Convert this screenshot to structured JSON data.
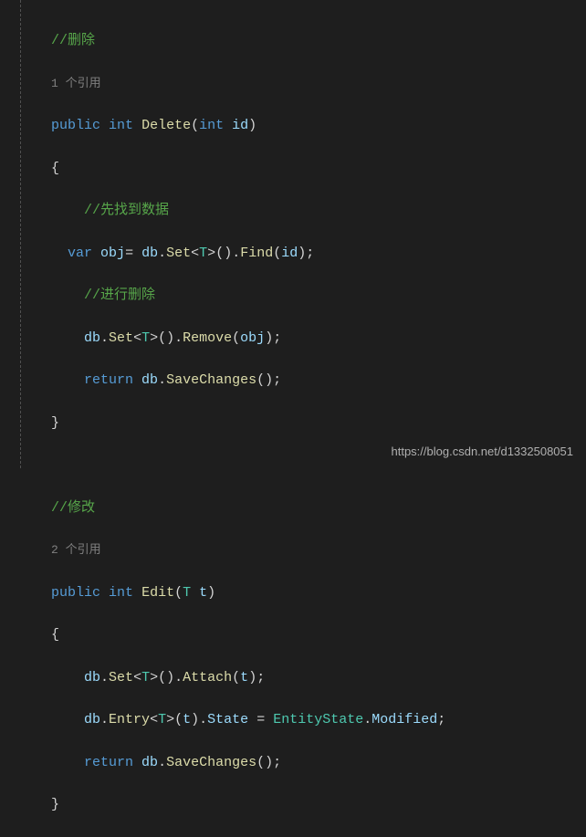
{
  "code": {
    "delete": {
      "comment_title": "//删除",
      "ref_count": "1 个引用",
      "sig_public": "public",
      "sig_int": "int",
      "sig_name": "Delete",
      "sig_paren_open": "(",
      "sig_param_type": "int",
      "sig_param_name": "id",
      "sig_paren_close": ")",
      "brace_open": "{",
      "comment_find": "//先找到数据",
      "l_var": "var",
      "l_obj": "obj",
      "l_eq": "=",
      "l_db": "db",
      "l_dot1": ".",
      "l_set": "Set",
      "l_lt1": "<",
      "l_T1": "T",
      "l_gt1": ">",
      "l_paren1": "()",
      "l_dot2": ".",
      "l_find": "Find",
      "l_po": "(",
      "l_id": "id",
      "l_pc": ")",
      "l_semi": ";",
      "comment_del": "//进行删除",
      "r_db": "db",
      "r_dot1": ".",
      "r_set": "Set",
      "r_lt": "<",
      "r_T": "T",
      "r_gt": ">",
      "r_paren": "()",
      "r_dot2": ".",
      "r_remove": "Remove",
      "r_po": "(",
      "r_obj": "obj",
      "r_pc": ")",
      "r_semi": ";",
      "ret_return": "return",
      "ret_db": "db",
      "ret_dot": ".",
      "ret_save": "SaveChanges",
      "ret_paren": "()",
      "ret_semi": ";",
      "brace_close": "}"
    },
    "edit": {
      "comment_title": "//修改",
      "ref_count": "2 个引用",
      "sig_public": "public",
      "sig_int": "int",
      "sig_name": "Edit",
      "sig_paren_open": "(",
      "sig_param_type": "T",
      "sig_param_name": "t",
      "sig_paren_close": ")",
      "brace_open": "{",
      "a_db": "db",
      "a_dot1": ".",
      "a_set": "Set",
      "a_lt": "<",
      "a_T": "T",
      "a_gt": ">",
      "a_paren": "()",
      "a_dot2": ".",
      "a_attach": "Attach",
      "a_po": "(",
      "a_t": "t",
      "a_pc": ")",
      "a_semi": ";",
      "e_db": "db",
      "e_dot1": ".",
      "e_entry": "Entry",
      "e_lt": "<",
      "e_T": "T",
      "e_gt": ">",
      "e_po": "(",
      "e_t": "t",
      "e_pc": ")",
      "e_dot2": ".",
      "e_state": "State",
      "e_eq": "=",
      "e_estate": "EntityState",
      "e_dot3": ".",
      "e_mod": "Modified",
      "e_semi": ";",
      "ret_return": "return",
      "ret_db": "db",
      "ret_dot": ".",
      "ret_save": "SaveChanges",
      "ret_paren": "()",
      "ret_semi": ";",
      "brace_close": "}"
    }
  },
  "watermark": "https://blog.csdn.net/d1332508051"
}
